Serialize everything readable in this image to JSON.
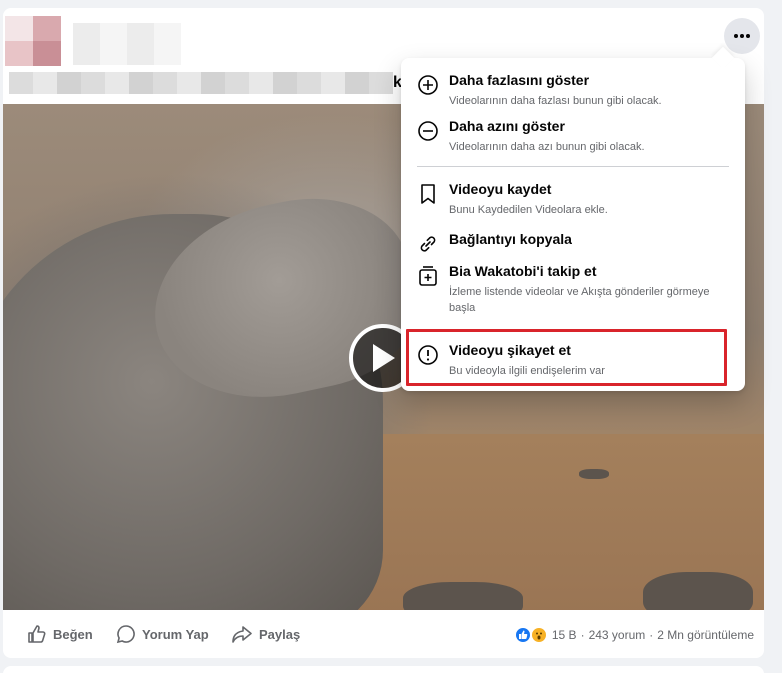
{
  "post": {
    "caption_tail": "k",
    "more_icon": "more-horizontal-icon"
  },
  "menu": {
    "items": [
      {
        "title": "Daha fazlasını göster",
        "subtitle": "Videolarının daha fazlası bunun gibi olacak.",
        "icon": "plus-circle-icon"
      },
      {
        "title": "Daha azını göster",
        "subtitle": "Videolarının daha azı bunun gibi olacak.",
        "icon": "minus-circle-icon"
      },
      {
        "title": "Videoyu kaydet",
        "subtitle": "Bunu Kaydedilen Videolara ekle.",
        "icon": "bookmark-icon"
      },
      {
        "title": "Bağlantıyı kopyala",
        "subtitle": "",
        "icon": "link-icon"
      },
      {
        "title": "Bia Wakatobi'i takip et",
        "subtitle": "İzleme listende videolar ve Akışta gönderiler görmeye başla",
        "icon": "follow-icon"
      },
      {
        "title": "Videoyu şikayet et",
        "subtitle": "Bu videoyla ilgili endişelerim var",
        "icon": "report-icon"
      }
    ],
    "highlight_color": "#d9242b"
  },
  "actions": {
    "like": "Beğen",
    "comment": "Yorum Yap",
    "share": "Paylaş"
  },
  "stats": {
    "reactions": "15 B",
    "separator": "·",
    "comments": "243 yorum",
    "views": "2 Mn görüntüleme"
  }
}
